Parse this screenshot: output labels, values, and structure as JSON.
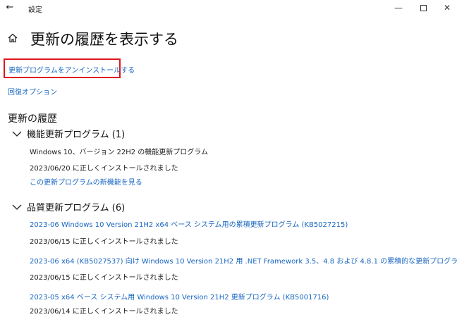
{
  "window": {
    "title": "設定",
    "back_icon": "←",
    "minimize_icon": "—",
    "close_icon": "✕"
  },
  "page": {
    "title": "更新の履歴を表示する"
  },
  "links": {
    "uninstall": "更新プログラムをアンインストールする",
    "recovery": "回復オプション"
  },
  "history": {
    "heading": "更新の履歴",
    "groups": [
      {
        "title": "機能更新プログラム (1)",
        "entries": [
          {
            "title": "Windows 10、バージョン 22H2 の機能更新プログラム",
            "status": "2023/06/20 に正しくインストールされました",
            "extra_link": "この更新プログラムの新機能を見る"
          }
        ]
      },
      {
        "title": "品質更新プログラム (6)",
        "entries": [
          {
            "title": "2023-06 Windows 10 Version 21H2 x64 ベース システム用の累積更新プログラム (KB5027215)",
            "status": "2023/06/15 に正しくインストールされました"
          },
          {
            "title": "2023-06 x64 (KB5027537) 向け Windows 10 Version 21H2 用 .NET Framework 3.5、4.8 および 4.8.1 の累積的な更新プログラム",
            "status": "2023/06/15 に正しくインストールされました"
          },
          {
            "title": "2023-05 x64 ベース システム用 Windows 10 Version 21H2 更新プログラム (KB5001716)",
            "status": "2023/06/14 に正しくインストールされました"
          }
        ]
      }
    ]
  },
  "colors": {
    "link": "#1866c0",
    "highlight_border": "#e0151d",
    "text": "#1a1a1a"
  }
}
